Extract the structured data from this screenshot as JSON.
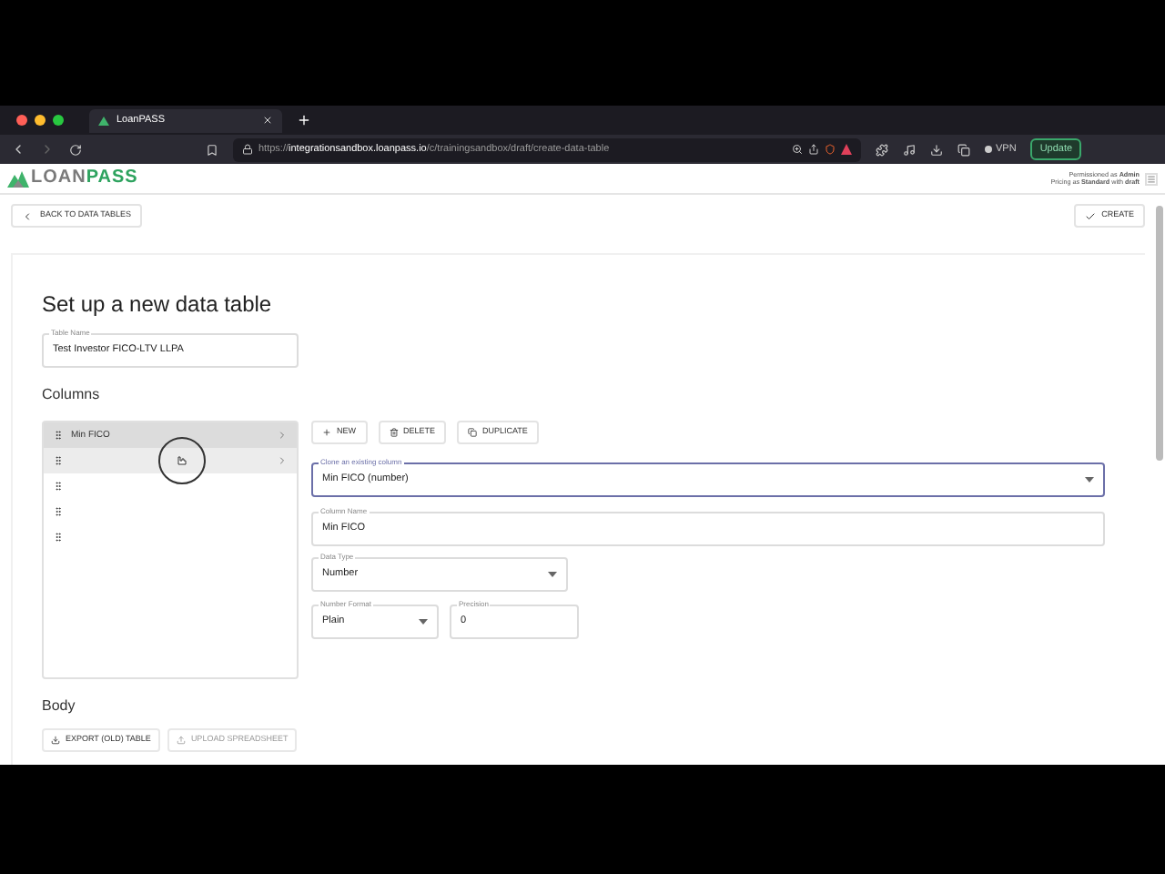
{
  "browser": {
    "tab": {
      "title": "LoanPASS"
    },
    "url": {
      "scheme": "https://",
      "host": "integrationsandbox.loanpass.io",
      "path": "/c/trainingsandbox/draft/create-data-table"
    },
    "vpn": "VPN",
    "update": "Update"
  },
  "header": {
    "logo": {
      "part1": "LOAN",
      "part2": "PASS"
    },
    "permission": "Permissioned as **Admin**",
    "pricing": "Pricing as **Standard** with **draft**"
  },
  "toolbar": {
    "back": "BACK TO DATA TABLES",
    "create": "CREATE"
  },
  "form": {
    "title": "Set up a new data table",
    "table_name": {
      "label": "Table Name",
      "value": "Test Investor FICO-LTV LLPA"
    },
    "columns_heading": "Columns",
    "columns": [
      {
        "name": "Min FICO",
        "selected": true,
        "hovered": false
      },
      {
        "selected": false,
        "hovered": true
      },
      {
        "selected": false,
        "hovered": false
      },
      {
        "selected": false,
        "hovered": false
      },
      {
        "selected": false,
        "hovered": false
      }
    ],
    "actions": [
      {
        "kind": "new",
        "label": "NEW"
      },
      {
        "kind": "delete",
        "label": "DELETE"
      },
      {
        "kind": "duplicate",
        "label": "DUPLICATE"
      }
    ],
    "clone": {
      "label": "Clone an existing column",
      "value": "Min FICO (number)",
      "focused": true
    },
    "column_name": {
      "label": "Column Name",
      "value": "Min FICO"
    },
    "data_type": {
      "label": "Data Type",
      "value": "Number"
    },
    "number_format": {
      "label": "Number Format",
      "value": "Plain"
    },
    "precision": {
      "label": "Precision",
      "value": "0"
    },
    "body_heading": "Body",
    "body_actions": [
      {
        "kind": "export",
        "label": "EXPORT (OLD) TABLE",
        "disabled": false
      },
      {
        "kind": "upload",
        "label": "UPLOAD SPREADSHEET",
        "disabled": true
      }
    ]
  }
}
